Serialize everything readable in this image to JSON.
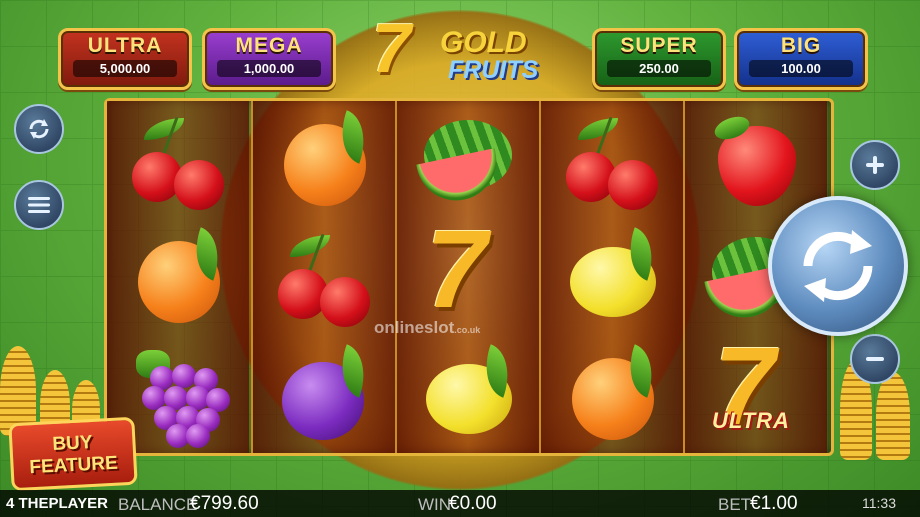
{
  "jackpots": [
    {
      "name": "ULTRA",
      "value": "5,000.00"
    },
    {
      "name": "MEGA",
      "value": "1,000.00"
    },
    {
      "name": "SUPER",
      "value": "250.00"
    },
    {
      "name": "BIG",
      "value": "100.00"
    }
  ],
  "logo": {
    "seven": "7",
    "gold": "GOLD",
    "fruits": "FRUITS"
  },
  "reels": [
    [
      "cherry",
      "orange",
      "grapes"
    ],
    [
      "orange",
      "cherry",
      "plum"
    ],
    [
      "watermelon",
      "seven",
      "lemon"
    ],
    [
      "cherry",
      "lemon",
      "orange"
    ],
    [
      "strawberry",
      "watermelon",
      "seven-ultra"
    ]
  ],
  "seven_ultra_label": "ULTRA",
  "buy_feature": {
    "line1": "BUY",
    "line2": "FEATURE"
  },
  "footer": {
    "brand": "4 THEPLAYER",
    "balance_label": "BALANCE",
    "balance_value": "€799.60",
    "win_label": "WIN",
    "win_value": "€0.00",
    "bet_label": "BET",
    "bet_value": "€1.00",
    "clock": "11:33"
  },
  "watermark": {
    "main": "onlineslot",
    "suffix": ".co.uk"
  },
  "icons": {
    "autoplay": "autoplay-icon",
    "menu": "menu-icon",
    "plus": "plus-icon",
    "minus": "minus-icon",
    "spin": "spin-arrows-icon"
  }
}
